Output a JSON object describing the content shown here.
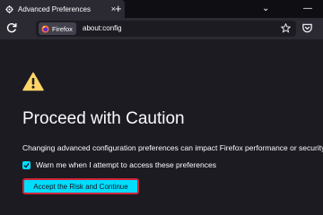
{
  "tab": {
    "title": "Advanced Preferences",
    "close_glyph": "×"
  },
  "tabbar": {
    "new_tab_glyph": "+",
    "list_glyph": "⌄",
    "minimize_glyph": "—"
  },
  "navbar": {
    "reload_icon": "reload-icon",
    "identity_label": "Firefox",
    "url": "about:config",
    "bookmark_icon": "star-icon",
    "pocket_icon": "pocket-icon"
  },
  "page": {
    "warning_icon": "warning-icon",
    "heading": "Proceed with Caution",
    "description": "Changing advanced configuration preferences can impact Firefox performance or security.",
    "checkbox_label": "Warn me when I attempt to access these preferences",
    "checkbox_checked": true,
    "accept_button": "Accept the Risk and Continue"
  },
  "colors": {
    "accent": "#00ddff",
    "warning": "#ffd567",
    "focus_outline": "#d0253a",
    "background": "#1c1b22"
  }
}
